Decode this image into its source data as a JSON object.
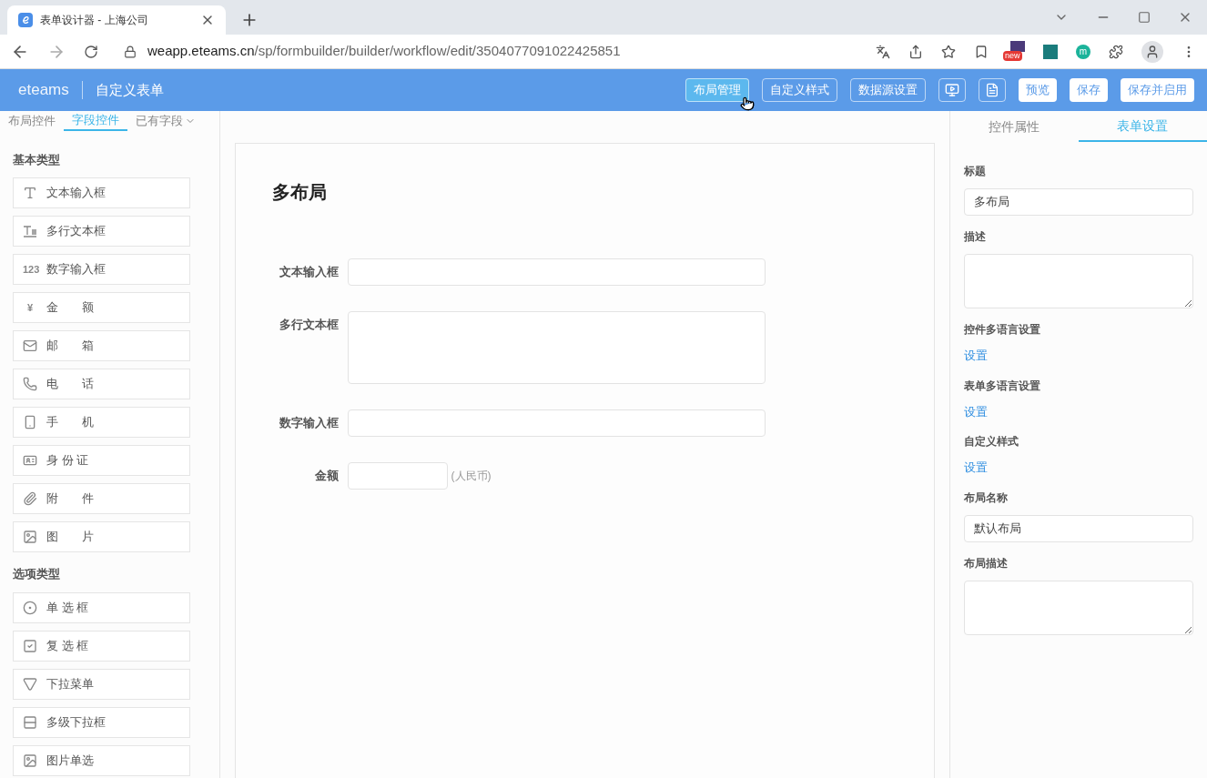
{
  "browser": {
    "tab_title": "表单设计器 - 上海公司",
    "url_host": "weapp.eteams.cn",
    "url_path": "/sp/formbuilder/builder/workflow/edit/3504077091022425851",
    "extension_badge": "new",
    "profile_initial": "m"
  },
  "header": {
    "logo": "eteams",
    "title": "自定义表单",
    "buttons": [
      {
        "kind": "outline",
        "label": "布局管理",
        "hovered": true
      },
      {
        "kind": "outline",
        "label": "自定义样式",
        "hovered": false
      },
      {
        "kind": "outline",
        "label": "数据源设置",
        "hovered": false
      },
      {
        "kind": "play",
        "hovered": false
      },
      {
        "kind": "doc",
        "hovered": false
      },
      {
        "kind": "solid",
        "label": "预览",
        "hovered": false
      },
      {
        "kind": "solid",
        "label": "保存",
        "hovered": false
      },
      {
        "kind": "solid",
        "label": "保存并启用",
        "hovered": false
      }
    ]
  },
  "left_tabs": [
    {
      "label": "布局控件",
      "selected": false
    },
    {
      "label": "字段控件",
      "selected": true
    },
    {
      "label": "已有字段",
      "selected": false,
      "dropdown": true
    }
  ],
  "groups": [
    {
      "title": "基本类型",
      "items": [
        {
          "kind": "text",
          "label": "文本输入框"
        },
        {
          "kind": "multiline",
          "label": "多行文本框"
        },
        {
          "kind": "number",
          "label": "数字输入框",
          "icon_text": "123"
        },
        {
          "kind": "money",
          "label": "金　　额",
          "icon_text": "¥"
        },
        {
          "kind": "mail",
          "label": "邮　　箱"
        },
        {
          "kind": "phone",
          "label": "电　　话"
        },
        {
          "kind": "mobile",
          "label": "手　　机"
        },
        {
          "kind": "id",
          "label": "身 份 证"
        },
        {
          "kind": "attach",
          "label": "附　　件"
        },
        {
          "kind": "image",
          "label": "图　　片"
        }
      ]
    },
    {
      "title": "选项类型",
      "items": [
        {
          "kind": "radio",
          "label": "单 选 框"
        },
        {
          "kind": "checkbox",
          "label": "复 选 框"
        },
        {
          "kind": "dropdown",
          "label": "下拉菜单"
        },
        {
          "kind": "cascade",
          "label": "多级下拉框"
        },
        {
          "kind": "image",
          "label": "图片单选"
        }
      ]
    }
  ],
  "form": {
    "title": "多布局",
    "fields": [
      {
        "kind": "text",
        "label": "文本输入框"
      },
      {
        "kind": "textarea",
        "label": "多行文本框"
      },
      {
        "kind": "text",
        "label": "数字输入框"
      },
      {
        "kind": "money",
        "label": "金额",
        "suffix": "(人民币)"
      }
    ]
  },
  "right_tabs": [
    {
      "label": "控件属性",
      "selected": false
    },
    {
      "label": "表单设置",
      "selected": true
    }
  ],
  "settings": [
    {
      "kind": "input",
      "label": "标题",
      "value": "多布局"
    },
    {
      "kind": "textarea",
      "label": "描述"
    },
    {
      "kind": "link",
      "label": "控件多语言设置",
      "link": "设置"
    },
    {
      "kind": "link",
      "label": "表单多语言设置",
      "link": "设置"
    },
    {
      "kind": "link",
      "label": "自定义样式",
      "link": "设置"
    },
    {
      "kind": "input",
      "label": "布局名称",
      "value": "默认布局"
    },
    {
      "kind": "textarea",
      "label": "布局描述"
    }
  ]
}
